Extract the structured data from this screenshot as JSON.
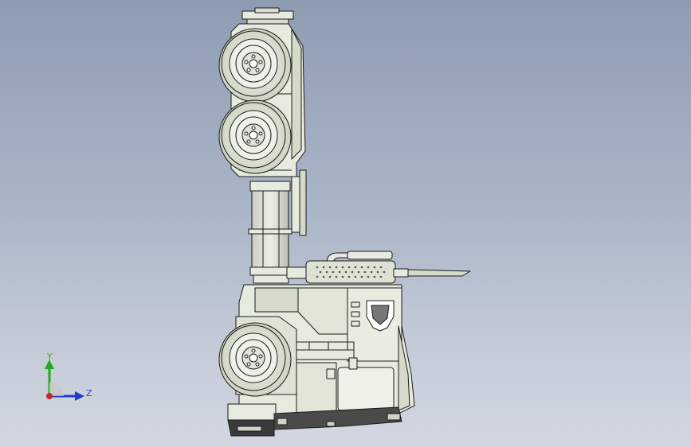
{
  "viewport": {
    "background_top": "#8e9cb2",
    "background_bottom": "#d2d7e0",
    "model_fill": "#e7ebdf",
    "model_edge": "#1a1a1a"
  },
  "triad": {
    "y_label": "Y",
    "z_label": "Z",
    "y_color": "#22aa22",
    "z_color": "#1f3ccf",
    "origin_color": "#d0202a"
  }
}
